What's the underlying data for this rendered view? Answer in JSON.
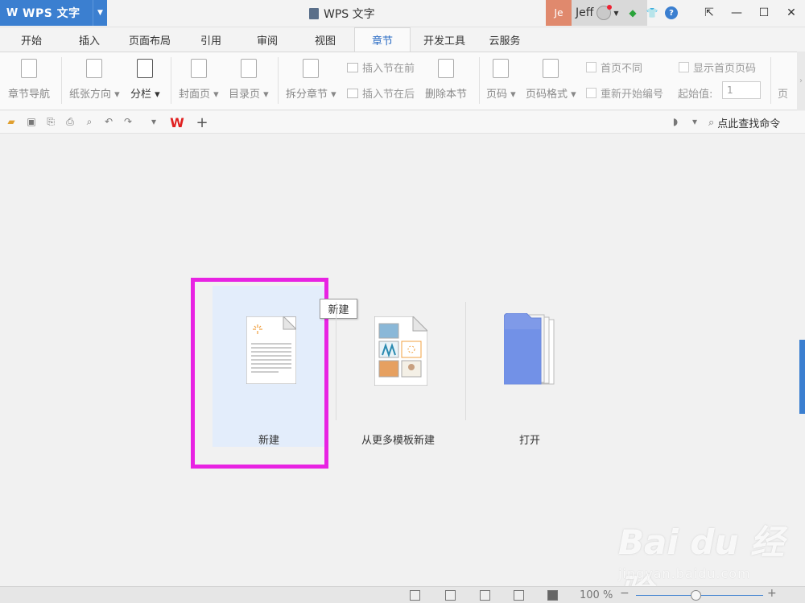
{
  "app": {
    "name": "WPS 文字",
    "logo_letter": "W",
    "window_title": "WPS 文字",
    "user_initials": "Je",
    "user_name": "Jeff"
  },
  "tabs": [
    {
      "label": "开始",
      "active": false
    },
    {
      "label": "插入",
      "active": false
    },
    {
      "label": "页面布局",
      "active": false
    },
    {
      "label": "引用",
      "active": false
    },
    {
      "label": "审阅",
      "active": false
    },
    {
      "label": "视图",
      "active": false
    },
    {
      "label": "章节",
      "active": true
    },
    {
      "label": "开发工具",
      "active": false
    },
    {
      "label": "云服务",
      "active": false
    }
  ],
  "ribbon": {
    "chapter_nav": "章节导航",
    "paper_orientation": "纸张方向",
    "columns": "分栏",
    "cover_page": "封面页",
    "toc_page": "目录页",
    "split_chapter": "拆分章节",
    "insert_section_before": "插入节在前",
    "insert_section_after": "插入节在后",
    "delete_section": "删除本节",
    "page_number": "页码",
    "page_number_format": "页码格式",
    "first_page_different": "首页不同",
    "restart_numbering": "重新开始编号",
    "show_first_page_number": "显示首页页码",
    "start_value_label": "起始值:",
    "start_value": "1",
    "page_more": "页"
  },
  "quickbar": {
    "find_command": "点此查找命令"
  },
  "start_panel": {
    "new_label": "新建",
    "new_tooltip": "新建",
    "template_label": "从更多模板新建",
    "open_label": "打开"
  },
  "status": {
    "zoom": "100 %"
  },
  "watermark": {
    "brand": "Bai du 经验",
    "url": "jingyan.baidu.com"
  }
}
